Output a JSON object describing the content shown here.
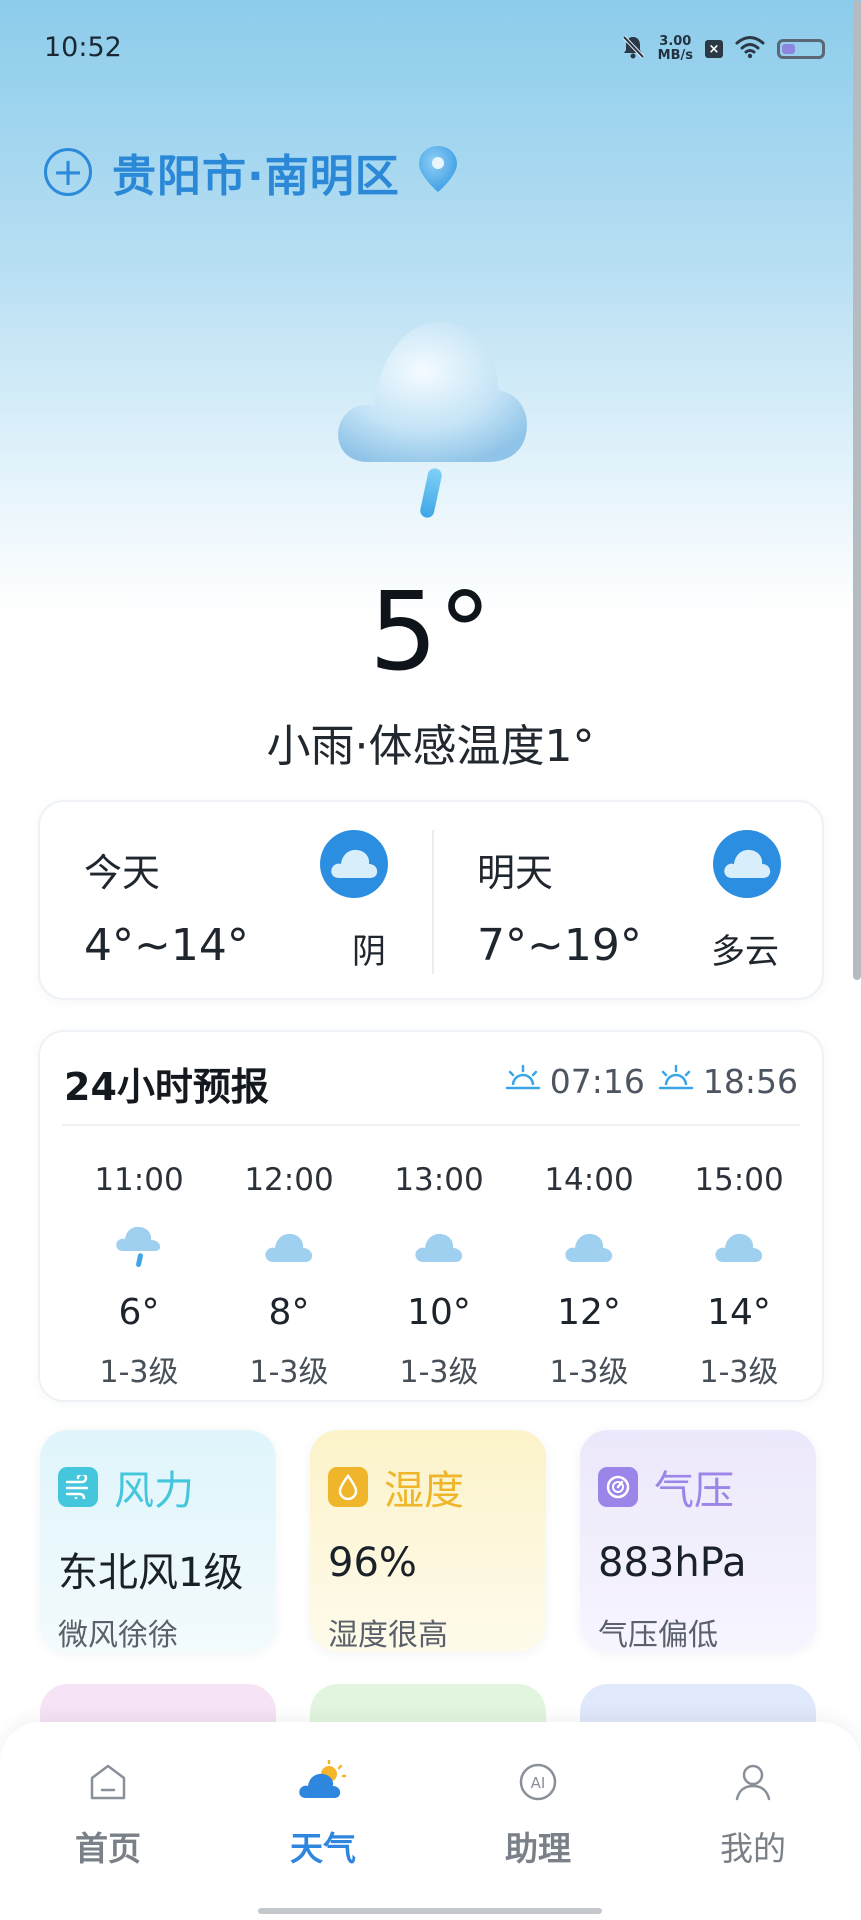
{
  "status_bar": {
    "time": "10:52",
    "net_speed_value": "3.00",
    "net_speed_unit": "MB/s",
    "sim_label": "×",
    "battery_level": 0.35
  },
  "location": {
    "name": "贵阳市·南明区",
    "add_symbol": "+"
  },
  "current": {
    "temperature": "5°",
    "description": "小雨·体感温度1°"
  },
  "days": [
    {
      "label": "今天",
      "range": "4°~14°",
      "condition": "阴"
    },
    {
      "label": "明天",
      "range": "7°~19°",
      "condition": "多云"
    }
  ],
  "forecast": {
    "title": "24小时预报",
    "sunrise": "07:16",
    "sunset": "18:56",
    "hours": [
      {
        "time": "11:00",
        "icon": "light-rain-icon",
        "temp": "6°",
        "wind": "1-3级"
      },
      {
        "time": "12:00",
        "icon": "cloudy-icon",
        "temp": "8°",
        "wind": "1-3级"
      },
      {
        "time": "13:00",
        "icon": "cloudy-icon",
        "temp": "10°",
        "wind": "1-3级"
      },
      {
        "time": "14:00",
        "icon": "cloudy-icon",
        "temp": "12°",
        "wind": "1-3级"
      },
      {
        "time": "15:00",
        "icon": "cloudy-icon",
        "temp": "14°",
        "wind": "1-3级"
      }
    ]
  },
  "metrics": [
    {
      "label": "风力",
      "value": "东北风1级",
      "sub": "微风徐徐",
      "color": "#44c6dc"
    },
    {
      "label": "湿度",
      "value": "96%",
      "sub": "湿度很高",
      "color": "#f0b62b"
    },
    {
      "label": "气压",
      "value": "883hPa",
      "sub": "气压偏低",
      "color": "#9b85e8"
    }
  ],
  "nav": [
    {
      "label": "首页",
      "icon": "home-icon"
    },
    {
      "label": "天气",
      "icon": "weather-icon"
    },
    {
      "label": "助理",
      "icon": "ai-icon"
    },
    {
      "label": "我的",
      "icon": "profile-icon"
    }
  ],
  "colors": {
    "accent": "#2e86de",
    "location": "#2a88d6"
  }
}
